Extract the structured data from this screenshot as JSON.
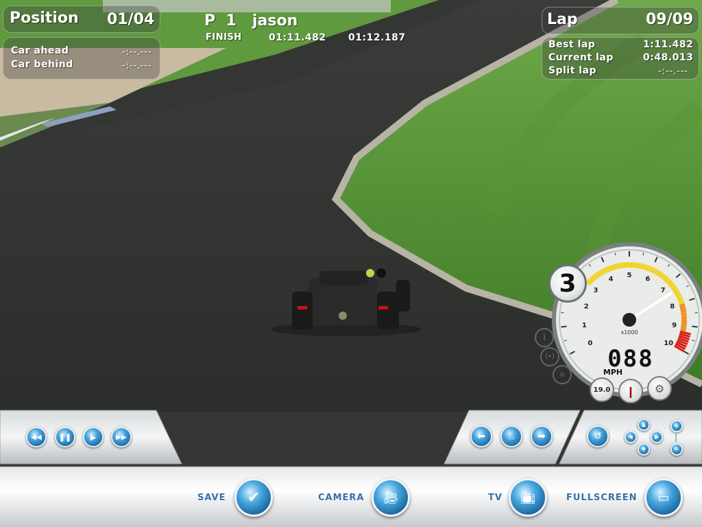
{
  "hud": {
    "position_label": "Position",
    "position_value": "01/04",
    "car_ahead_label": "Car ahead",
    "car_ahead_value": "-:--.---",
    "car_behind_label": "Car behind",
    "car_behind_value": "-:--.---",
    "driver_pos": "P  1",
    "driver_name": "jason",
    "status": "FINISH",
    "time_1": "01:11.482",
    "time_2": "01:12.187",
    "lap_label": "Lap",
    "lap_value": "09/09",
    "best_lap_label": "Best lap",
    "best_lap_value": "1:11.482",
    "current_lap_label": "Current lap",
    "current_lap_value": "0:48.013",
    "split_lap_label": "Split lap",
    "split_lap_value": "-:--.---"
  },
  "gauge": {
    "gear": "3",
    "speed": "088",
    "unit": "MPH",
    "multiplier": "x1000",
    "ticks": [
      "0",
      "1",
      "2",
      "3",
      "4",
      "5",
      "6",
      "7",
      "8",
      "9",
      "10"
    ],
    "fuel": "19.0",
    "rpm": 7.4
  },
  "bottom": {
    "save_label": "SAVE",
    "camera_label": "CAMERA",
    "tv_label": "TV",
    "fullscreen_label": "FULLSCREEN"
  },
  "colors": {
    "accent_blue": "#2a86c8",
    "label_blue": "#3a6fa6",
    "rpm_yellow": "#f2d21a",
    "rpm_orange": "#f08a1a",
    "rpm_red": "#d81a10"
  }
}
